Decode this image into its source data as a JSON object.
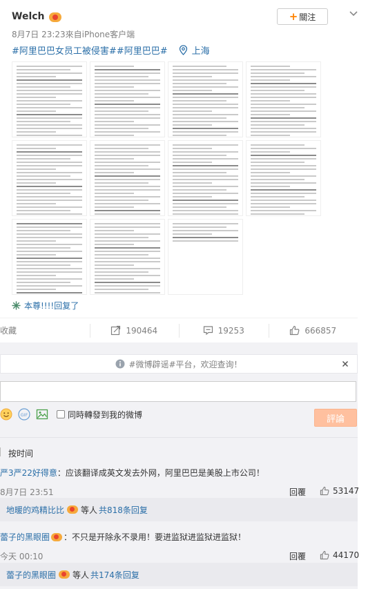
{
  "post": {
    "username": "Welch",
    "meta": "8月7日 23:23來自iPhone客户端",
    "follow_label": "關注",
    "hashtag1": "#阿里巴巴女员工被侵害#",
    "hashtag2": "#阿里巴巴#",
    "location": "上海",
    "wall_link": "本尊!!!!回复了",
    "gallery_count": 11
  },
  "actions": {
    "favorite_label": "收藏",
    "repost_count": "190464",
    "comment_count": "19253",
    "like_count": "666857"
  },
  "comment_panel": {
    "notice": "#微博辟谣#平台，欢迎查询！",
    "repost_check_label": "同時轉發到我的微博",
    "submit_label": "評論",
    "sort_label": "按时间"
  },
  "comments": [
    {
      "name": "严3严22好得意",
      "text": "：应该翻译成英文发去外网，阿里巴巴是美股上市公司！",
      "time": "8月7日 23:51",
      "reply_label": "回覆",
      "likes": "53147",
      "sub_name": "地暖的鸡精比比",
      "sub_text": "等人",
      "sub_count": "共818条回复"
    },
    {
      "name": "蕾子的黑眼圈",
      "text": "：不只是开除永不录用！要进监狱进监狱进监狱！",
      "time": "今天 00:10",
      "reply_label": "回覆",
      "likes": "44170",
      "sub_name": "蕾子的黑眼圈",
      "sub_text": "等人",
      "sub_count": "共174条回复"
    }
  ],
  "colors": {
    "link": "#2b6fa8",
    "accent": "#ff8200",
    "submit_bg": "#ffc09f"
  }
}
